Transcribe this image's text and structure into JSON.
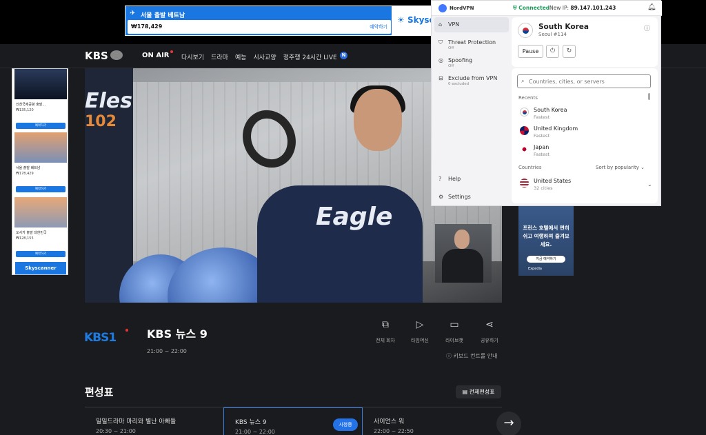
{
  "top_ad": {
    "title": "서울 출발 베트남",
    "price": "₩178,429",
    "cta": "예약하기",
    "brand": "Skysc"
  },
  "kbs_nav": {
    "logo": "KBS",
    "on_air": "ON AIR",
    "items": [
      "다시보기",
      "드라마",
      "예능",
      "시사교양",
      "정주행 24시간 LIVE"
    ],
    "new_badge": "N"
  },
  "left_ad": {
    "items": [
      {
        "title": "인천국제공항 출발...",
        "price": "₩135,120",
        "cta": "예약하기"
      },
      {
        "title": "서울 출발 베트남",
        "price": "₩178,429",
        "cta": "예약하기"
      },
      {
        "title": "오사카 출발 대한민국",
        "price": "₩128,155",
        "cta": "예약하기"
      }
    ],
    "brand": "Skyscanner"
  },
  "video": {
    "left_jersey": "Eles",
    "left_number": "102",
    "jersey_text": "Eagle"
  },
  "right_ad": {
    "text": "프린스 호텔에서 편히 쉬고 여행하며 즐겨보세요.",
    "cta": "지금 예약하기",
    "brand": "Expedia"
  },
  "nordvpn": {
    "logo": "NordVPN",
    "status": "Connected",
    "ip_label": "New IP:",
    "ip": "89.147.101.243",
    "nav": [
      {
        "label": "VPN",
        "sub": ""
      },
      {
        "label": "Threat Protection",
        "sub": "Off"
      },
      {
        "label": "Spoofing",
        "sub": "Off"
      },
      {
        "label": "Exclude from VPN",
        "sub": "0 excluded"
      }
    ],
    "help": "Help",
    "settings": "Settings",
    "country": "South Korea",
    "server": "Seoul #114",
    "pause": "Pause",
    "search_placeholder": "Countries, cities, or servers",
    "recents_label": "Recents",
    "recents": [
      {
        "name": "South Korea",
        "sub": "Fastest"
      },
      {
        "name": "United Kingdom",
        "sub": "Fastest"
      },
      {
        "name": "Japan",
        "sub": "Fastest"
      }
    ],
    "countries_label": "Countries",
    "sort_label": "Sort by popularity",
    "countries": [
      {
        "name": "United States",
        "sub": "32 cities"
      }
    ]
  },
  "show": {
    "channel": "KBS1",
    "title": "KBS 뉴스 9",
    "time": "21:00 ~ 22:00",
    "controls": [
      "전체 회차",
      "타임머신",
      "라이브챗",
      "공유하기"
    ],
    "keyboard": "키보드 컨트롤 안내"
  },
  "schedule": {
    "heading": "편성표",
    "all_button": "전체편성표",
    "items": [
      {
        "title": "일일드라마 마리와 별난 아빠들",
        "time": "20:30 ~ 21:00"
      },
      {
        "title": "KBS 뉴스 9",
        "time": "21:00 ~ 22:00",
        "badge": "시청중"
      },
      {
        "title": "사이언스 워",
        "time": "22:00 ~ 22:50"
      }
    ]
  }
}
